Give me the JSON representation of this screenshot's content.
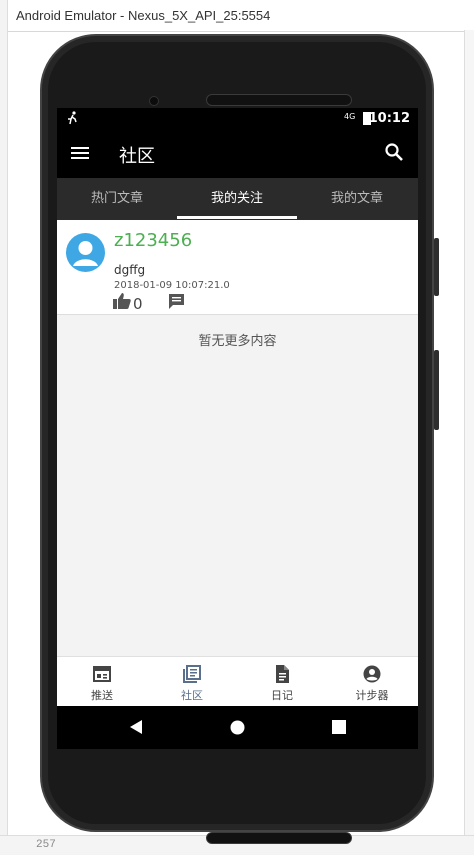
{
  "window": {
    "title": "Android Emulator - Nexus_5X_API_25:5554"
  },
  "editor": {
    "line_number": "257"
  },
  "statusbar": {
    "time": "10:12",
    "network": "4G"
  },
  "toolbar": {
    "title": "社区"
  },
  "tabs": [
    {
      "label": "热门文章"
    },
    {
      "label": "我的关注"
    },
    {
      "label": "我的文章"
    }
  ],
  "post": {
    "author": "z123456",
    "content": "dgffg",
    "timestamp": "2018-01-09 10:07:21.0",
    "likes": "0"
  },
  "feed": {
    "no_more": "暂无更多内容"
  },
  "bottom_nav": [
    {
      "label": "推送",
      "icon": "calendar-icon"
    },
    {
      "label": "社区",
      "icon": "library-books-icon"
    },
    {
      "label": "日记",
      "icon": "document-icon"
    },
    {
      "label": "计步器",
      "icon": "account-circle-icon"
    }
  ],
  "colors": {
    "accent_green": "#4caf50",
    "avatar_blue": "#3fa8e4",
    "nav_active": "#5a6f8c"
  }
}
